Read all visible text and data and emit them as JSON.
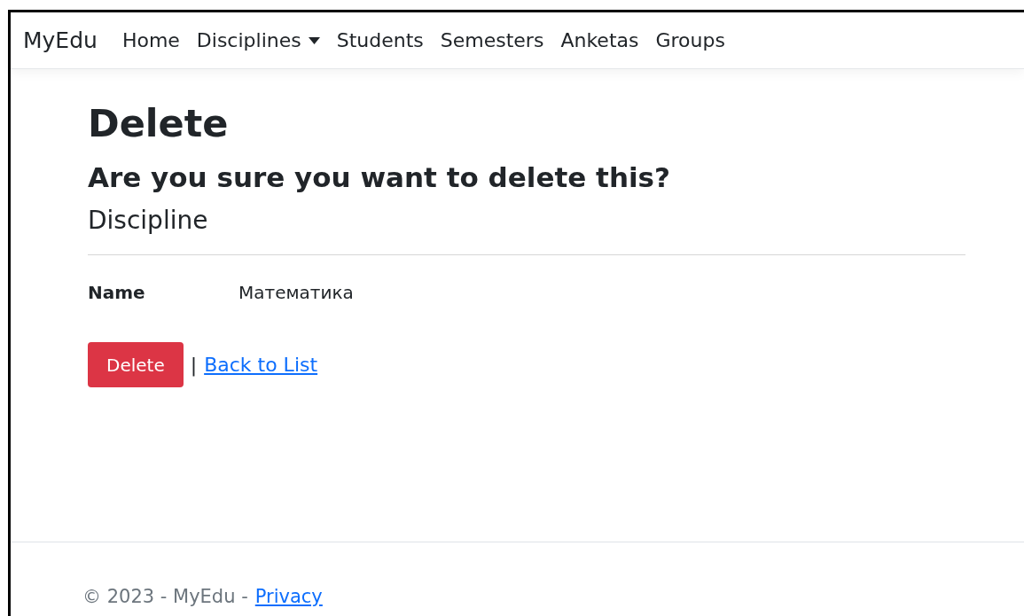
{
  "navbar": {
    "brand": "MyEdu",
    "items": [
      {
        "label": "Home",
        "kind": "link"
      },
      {
        "label": "Disciplines",
        "kind": "dropdown"
      },
      {
        "label": "Students",
        "kind": "link"
      },
      {
        "label": "Semesters",
        "kind": "link"
      },
      {
        "label": "Anketas",
        "kind": "link"
      },
      {
        "label": "Groups",
        "kind": "link"
      }
    ]
  },
  "page": {
    "title": "Delete",
    "question": "Are you sure you want to delete this?",
    "entity": "Discipline",
    "fields": [
      {
        "label": "Name",
        "value": "Математика"
      }
    ],
    "delete_button": "Delete",
    "separator": "|",
    "back_link": "Back to List"
  },
  "footer": {
    "text": "© 2023 - MyEdu -",
    "link": "Privacy"
  }
}
